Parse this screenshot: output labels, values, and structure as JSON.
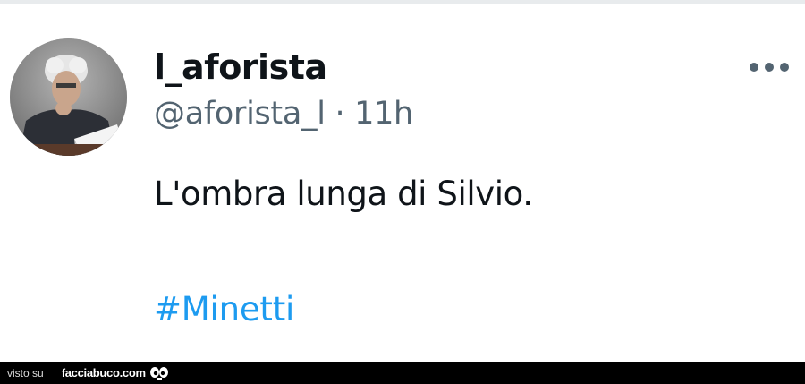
{
  "tweet": {
    "display_name": "l_aforista",
    "handle": "@aforista_l",
    "separator": "·",
    "time": "11h",
    "text": "L'ombra lunga di Silvio.",
    "hashtag": "#Minetti",
    "more_icon": "more-horizontal-icon",
    "avatar_description": "profile-photo"
  },
  "footer": {
    "visto_label": "visto su",
    "brand": "facciabuco.com",
    "brand_icon": "eyes-icon"
  },
  "colors": {
    "text_primary": "#0f1419",
    "text_secondary": "#536471",
    "link": "#1d9bf0",
    "footer_bg": "#000000"
  }
}
